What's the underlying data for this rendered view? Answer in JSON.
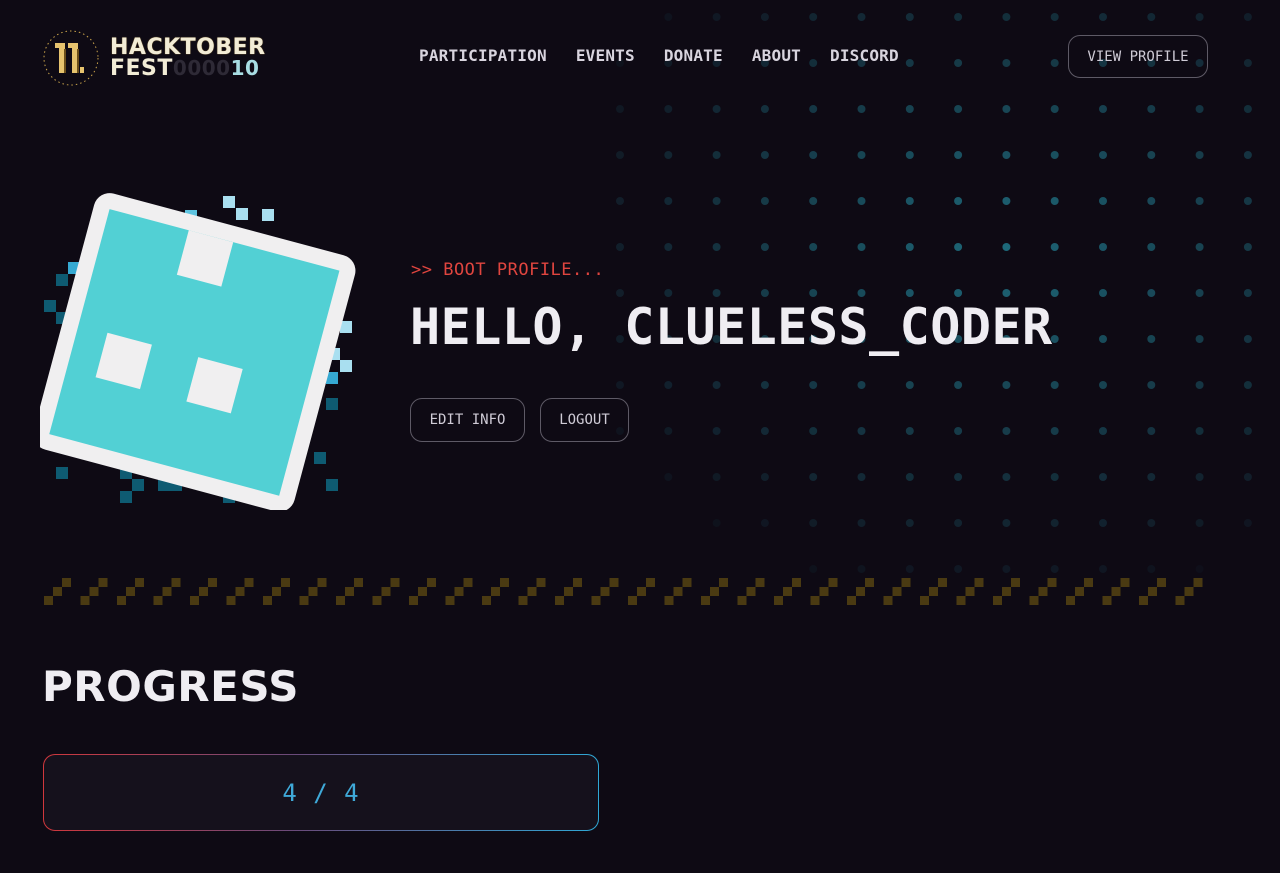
{
  "header": {
    "logo": {
      "line1": "HACKTOBER",
      "line2_fest": "FEST",
      "line2_zeros": "0000",
      "line2_num": "10"
    },
    "nav": [
      {
        "label": "PARTICIPATION"
      },
      {
        "label": "EVENTS"
      },
      {
        "label": "DONATE"
      },
      {
        "label": "ABOUT"
      },
      {
        "label": "DISCORD"
      }
    ],
    "view_profile_label": "VIEW PROFILE"
  },
  "hero": {
    "boot_text": ">> BOOT PROFILE...",
    "greeting": "HELLO, CLUELESS_CODER",
    "edit_label": "EDIT INFO",
    "logout_label": "LOGOUT"
  },
  "progress": {
    "title": "PROGRESS",
    "value": "4 / 4",
    "completed": 4,
    "total": 4
  },
  "colors": {
    "background": "#0e0a14",
    "accent_red": "#e0453f",
    "accent_teal": "#52d0d4",
    "accent_blue": "#3fa9d8",
    "divider_gold": "#4a3a12"
  }
}
